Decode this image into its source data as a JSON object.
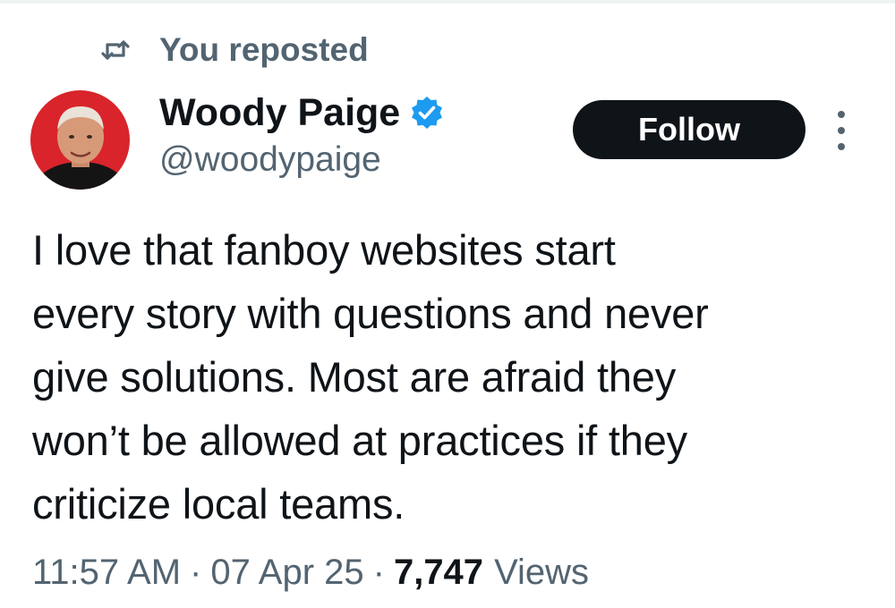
{
  "repost": {
    "icon": "repost-icon",
    "label": "You reposted"
  },
  "author": {
    "display_name": "Woody Paige",
    "handle": "@woodypaige",
    "verified_icon": "verified-badge-icon",
    "verified_color": "#1d9bf0"
  },
  "actions": {
    "follow_label": "Follow",
    "more_icon": "more-vertical-icon"
  },
  "tweet": {
    "text": "I love that fanboy websites start\nevery story with questions and never\ngive solutions. Most are afraid they\nwon’t be allowed at practices if they\ncriticize local teams."
  },
  "meta": {
    "time": "11:57 AM",
    "separator": "·",
    "date": "07 Apr 25",
    "views_count": "7,747",
    "views_label": "Views"
  },
  "colors": {
    "text_primary": "#0f1419",
    "text_secondary": "#536471",
    "follow_bg": "#0f1419",
    "avatar_bg": "#d9242b"
  }
}
